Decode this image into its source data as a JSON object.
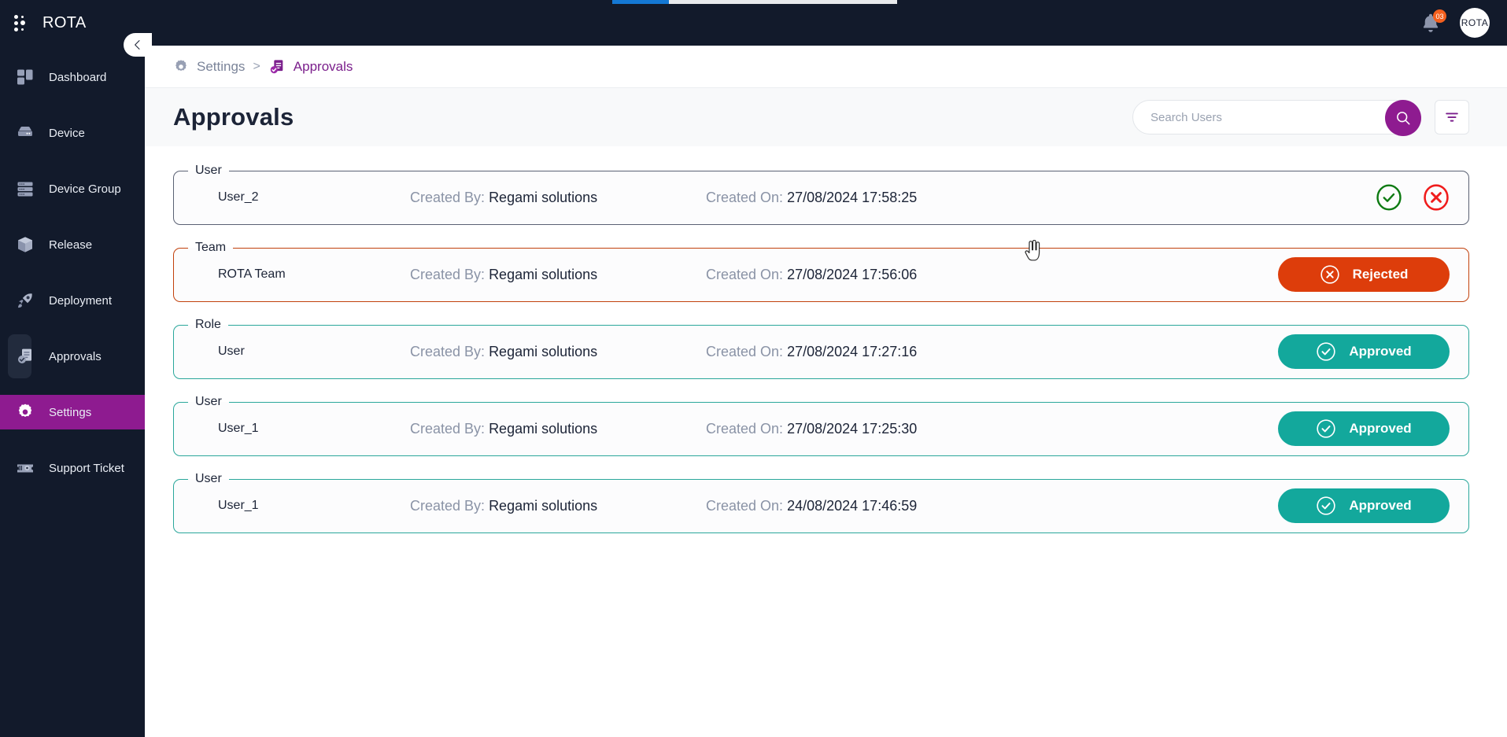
{
  "brand": {
    "name": "ROTA",
    "avatar_label": "ROTA"
  },
  "header": {
    "notification_count": "03",
    "bell_icon": "bell-icon",
    "logo_icon": "dots-grid-icon"
  },
  "progress": {
    "percent": 20,
    "color": "#1478d4",
    "track": "#e8eaec"
  },
  "sidebar": {
    "collapse_icon": "chevron-left-icon",
    "items": [
      {
        "label": "Dashboard",
        "icon": "dashboard-icon",
        "active": false
      },
      {
        "label": "Device",
        "icon": "device-icon",
        "active": false
      },
      {
        "label": "Device Group",
        "icon": "device-group-icon",
        "active": false
      },
      {
        "label": "Release",
        "icon": "package-icon",
        "active": false
      },
      {
        "label": "Deployment",
        "icon": "rocket-icon",
        "active": false
      },
      {
        "label": "Approvals",
        "icon": "approvals-icon",
        "active": false
      },
      {
        "label": "Settings",
        "icon": "gear-icon",
        "active": true
      },
      {
        "label": "Support Ticket",
        "icon": "ticket-icon",
        "active": false
      }
    ]
  },
  "breadcrumb": {
    "parent": "Settings",
    "separator": ">",
    "current": "Approvals",
    "parent_icon": "gear-icon",
    "current_icon": "approvals-doc-icon"
  },
  "page": {
    "title": "Approvals"
  },
  "search": {
    "placeholder": "Search Users",
    "value": "",
    "button_icon": "search-icon"
  },
  "filter": {
    "icon": "filter-icon"
  },
  "labels": {
    "created_by": "Created By:",
    "created_on": "Created On:"
  },
  "colors": {
    "brand_purple": "#8e1b90",
    "approved_teal": "#13a89c",
    "rejected_orange": "#dd3d0b",
    "approve_green": "#1a7a1a",
    "reject_red": "#ee1c1c",
    "sidebar_dark": "#121a2b"
  },
  "approvals": [
    {
      "category": "User",
      "name": "User_2",
      "created_by": "Regami solutions",
      "created_on": "27/08/2024 17:58:25",
      "state": "pending",
      "action_approve": "approve-icon",
      "action_reject": "reject-icon"
    },
    {
      "category": "Team",
      "name": "ROTA Team",
      "created_by": "Regami solutions",
      "created_on": "27/08/2024 17:56:06",
      "state": "rejected",
      "status_label": "Rejected"
    },
    {
      "category": "Role",
      "name": "User",
      "created_by": "Regami solutions",
      "created_on": "27/08/2024 17:27:16",
      "state": "approved",
      "status_label": "Approved"
    },
    {
      "category": "User",
      "name": "User_1",
      "created_by": "Regami solutions",
      "created_on": "27/08/2024 17:25:30",
      "state": "approved",
      "status_label": "Approved"
    },
    {
      "category": "User",
      "name": "User_1",
      "created_by": "Regami solutions",
      "created_on": "24/08/2024 17:46:59",
      "state": "approved",
      "status_label": "Approved"
    }
  ]
}
